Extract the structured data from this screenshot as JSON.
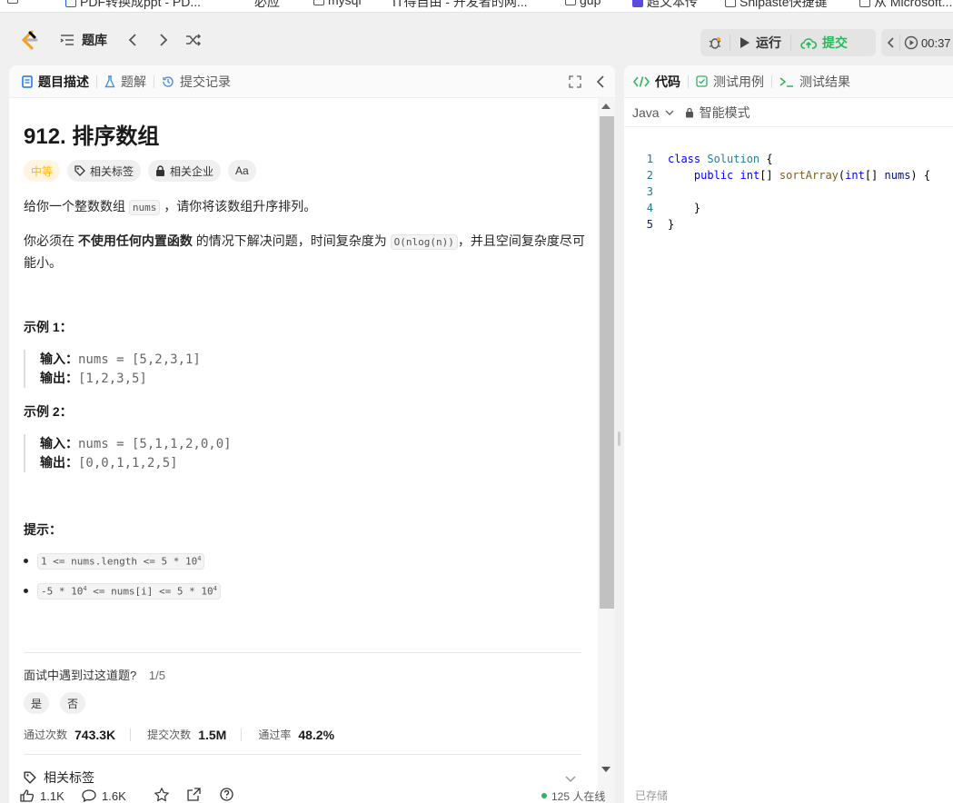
{
  "bookmarks": [
    {
      "label": "PDF转换成ppt - PD..."
    },
    {
      "label": "必应"
    },
    {
      "label": "mysql"
    },
    {
      "label": "IT得自由 - 开发者的网..."
    },
    {
      "label": "gup"
    },
    {
      "label": "超文本传"
    },
    {
      "label": "Snipaste快捷键"
    },
    {
      "label": "从 Microsoft..."
    }
  ],
  "topnav": {
    "problem_bank": "题库",
    "run": "运行",
    "submit": "提交",
    "timer": "00:37"
  },
  "left_tabs": [
    {
      "label": "题目描述"
    },
    {
      "label": "题解"
    },
    {
      "label": "提交记录"
    }
  ],
  "problem": {
    "title": "912. 排序数组",
    "difficulty": "中等",
    "tags_label": "相关标签",
    "company_label": "相关企业",
    "font_label": "Aa",
    "desc1_a": "给你一个整数数组",
    "desc1_code": "nums",
    "desc1_b": "，请你将该数组升序排列。",
    "desc2_a": "你必须在",
    "desc2_bold": "不使用任何内置函数",
    "desc2_b": "的情况下解决问题，时间复杂度为",
    "desc2_code": "O(nlog(n))",
    "desc2_c": "，并且空间复杂度尽可能小。",
    "examples": [
      {
        "heading": "示例 1：",
        "input_label": "输入：",
        "input": "nums = [5,2,3,1]",
        "output_label": "输出：",
        "output": "[1,2,3,5]"
      },
      {
        "heading": "示例 2：",
        "input_label": "输入：",
        "input": "nums = [5,1,1,2,0,0]",
        "output_label": "输出：",
        "output": "[0,0,1,1,2,5]"
      }
    ],
    "hints_heading": "提示：",
    "hints": [
      "1 <= nums.length <= 5 * 10",
      "-5 * 10 <= nums[i] <= 5 * 10"
    ],
    "hint_sup": "4",
    "interview_q": "面试中遇到过这道题?",
    "interview_count": "1/5",
    "yes": "是",
    "no": "否",
    "stats": {
      "accepted_label": "通过次数",
      "accepted": "743.3K",
      "submissions_label": "提交次数",
      "submissions": "1.5M",
      "rate_label": "通过率",
      "rate": "48.2%"
    },
    "related_tags": "相关标签"
  },
  "footer": {
    "likes": "1.1K",
    "comments": "1.6K",
    "online": "125 人在线"
  },
  "editor_tabs": [
    {
      "label": "代码"
    },
    {
      "label": "测试用例"
    },
    {
      "label": "测试结果"
    }
  ],
  "editor": {
    "language": "Java",
    "mode": "智能模式",
    "saved": "已存储",
    "line_numbers": [
      "1",
      "2",
      "3",
      "4",
      "5"
    ]
  }
}
